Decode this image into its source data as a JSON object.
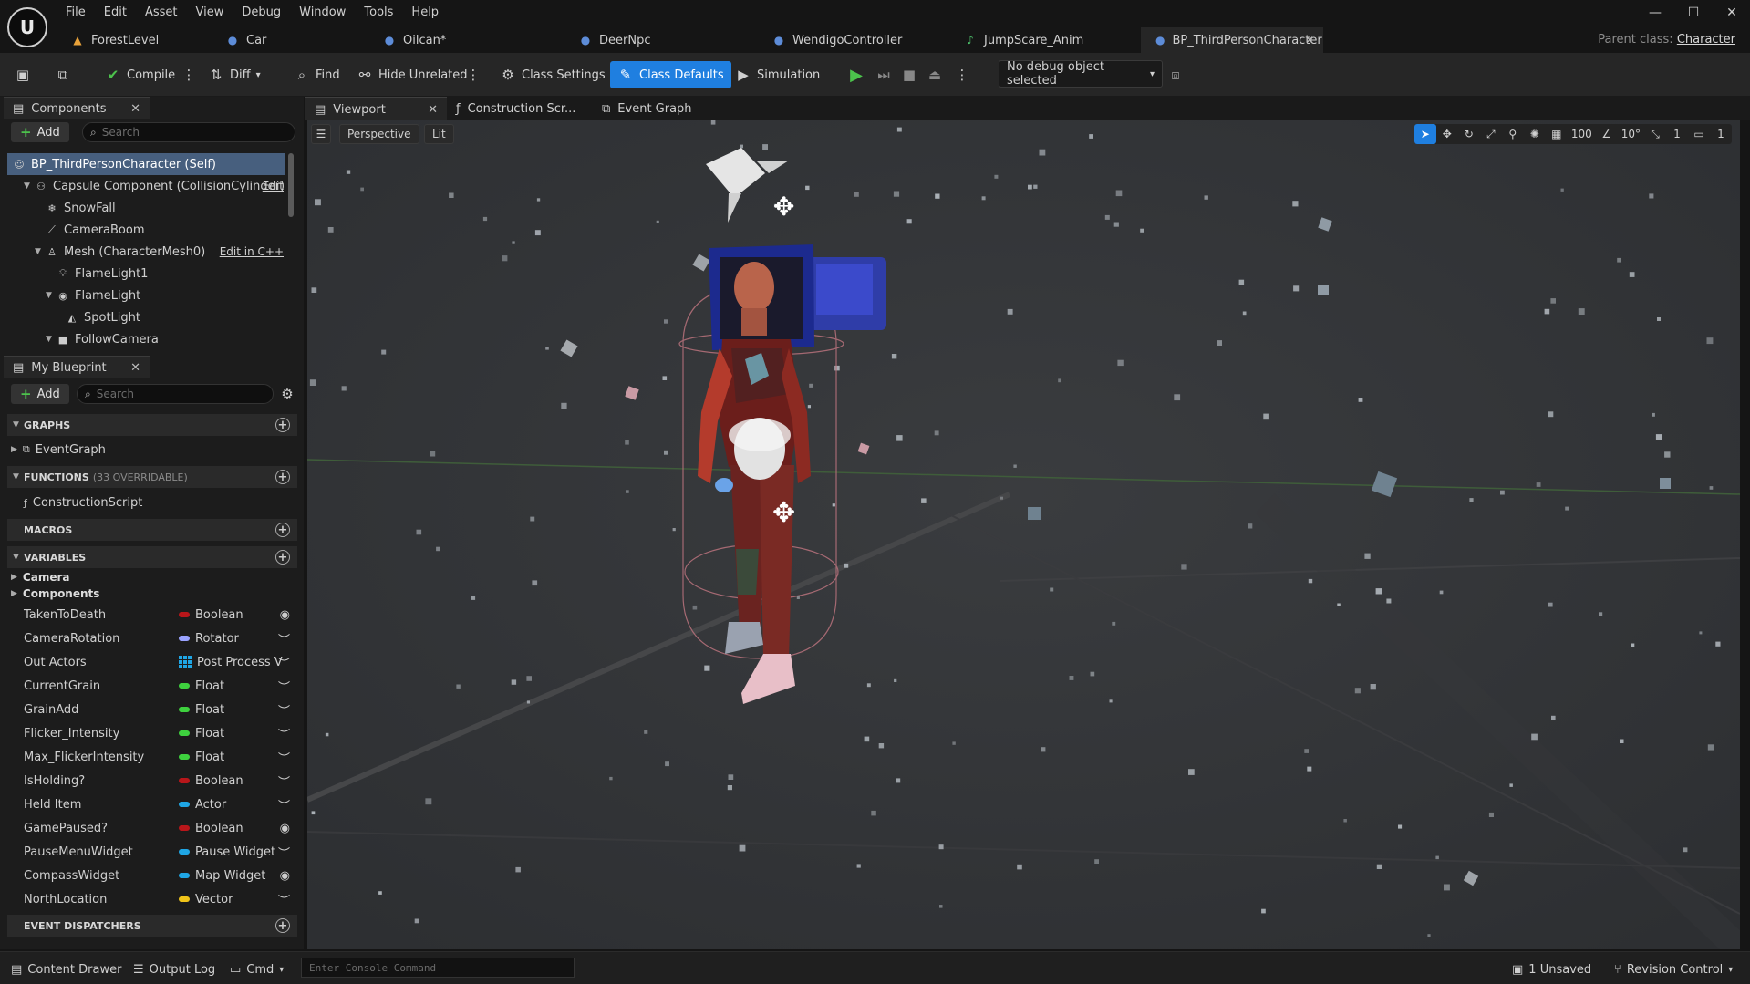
{
  "menu": [
    "File",
    "Edit",
    "Asset",
    "View",
    "Debug",
    "Window",
    "Tools",
    "Help"
  ],
  "window_controls": {
    "minimize": "—",
    "maximize": "☐",
    "close": "✕"
  },
  "tabs": [
    {
      "label": "ForestLevel",
      "icon": "level-icon"
    },
    {
      "label": "Car",
      "icon": "blueprint-icon"
    },
    {
      "label": "Oilcan*",
      "icon": "blueprint-icon"
    },
    {
      "label": "DeerNpc",
      "icon": "blueprint-icon"
    },
    {
      "label": "WendigoController",
      "icon": "blueprint-icon"
    },
    {
      "label": "JumpScare_Anim",
      "icon": "animation-icon"
    },
    {
      "label": "BP_ThirdPersonCharacter",
      "icon": "blueprint-icon",
      "active": true
    }
  ],
  "parent_class": {
    "label": "Parent class:",
    "value": "Character"
  },
  "toolbar": {
    "compile": "Compile",
    "diff": "Diff",
    "find": "Find",
    "hide_unrelated": "Hide Unrelated",
    "class_settings": "Class Settings",
    "class_defaults": "Class Defaults",
    "simulation": "Simulation",
    "debug_object": "No debug object selected"
  },
  "components_panel": {
    "title": "Components",
    "add": "Add",
    "search_placeholder": "Search",
    "items": [
      {
        "label": "BP_ThirdPersonCharacter (Self)",
        "selected": true
      },
      {
        "label": "Capsule Component (CollisionCylinder)",
        "action": "Edit"
      },
      {
        "label": "SnowFall"
      },
      {
        "label": "CameraBoom"
      },
      {
        "label": "Mesh (CharacterMesh0)",
        "action": "Edit in C++"
      },
      {
        "label": "FlameLight1"
      },
      {
        "label": "FlameLight"
      },
      {
        "label": "SpotLight"
      },
      {
        "label": "FollowCamera"
      }
    ]
  },
  "my_blueprint": {
    "title": "My Blueprint",
    "add": "Add",
    "search_placeholder": "Search",
    "graphs": {
      "label": "GRAPHS",
      "items": [
        "EventGraph"
      ]
    },
    "functions": {
      "label": "FUNCTIONS",
      "sub": "(33 OVERRIDABLE)",
      "items": [
        "ConstructionScript"
      ]
    },
    "macros": {
      "label": "MACROS"
    },
    "variables": {
      "label": "VARIABLES",
      "categories": [
        "Camera",
        "Components"
      ],
      "items": [
        {
          "name": "TakenToDeath",
          "type": "Boolean",
          "color": "#b8161a",
          "visible": true
        },
        {
          "name": "CameraRotation",
          "type": "Rotator",
          "color": "#9aa3ff",
          "visible": false
        },
        {
          "name": "Out Actors",
          "type": "Post Process V",
          "color": "#1fa6e5",
          "visible": false,
          "grid": true
        },
        {
          "name": "CurrentGrain",
          "type": "Float",
          "color": "#3ed13e",
          "visible": false
        },
        {
          "name": "GrainAdd",
          "type": "Float",
          "color": "#3ed13e",
          "visible": false
        },
        {
          "name": "Flicker_Intensity",
          "type": "Float",
          "color": "#3ed13e",
          "visible": false
        },
        {
          "name": "Max_FlickerIntensity",
          "type": "Float",
          "color": "#3ed13e",
          "visible": false
        },
        {
          "name": "IsHolding?",
          "type": "Boolean",
          "color": "#b8161a",
          "visible": false
        },
        {
          "name": "Held Item",
          "type": "Actor",
          "color": "#1fa6e5",
          "visible": false
        },
        {
          "name": "GamePaused?",
          "type": "Boolean",
          "color": "#b8161a",
          "visible": true
        },
        {
          "name": "PauseMenuWidget",
          "type": "Pause Widget",
          "color": "#1fa6e5",
          "visible": false
        },
        {
          "name": "CompassWidget",
          "type": "Map Widget",
          "color": "#1fa6e5",
          "visible": true
        },
        {
          "name": "NorthLocation",
          "type": "Vector",
          "color": "#f0c419",
          "visible": false
        }
      ]
    },
    "event_dispatchers": {
      "label": "EVENT DISPATCHERS"
    }
  },
  "viewport_tabs": [
    {
      "label": "Viewport",
      "active": true
    },
    {
      "label": "Construction Scr..."
    },
    {
      "label": "Event Graph"
    }
  ],
  "viewport": {
    "perspective": "Perspective",
    "lit": "Lit",
    "grid_size": "100",
    "angle": "10°",
    "scale": "1",
    "camera_speed": "1"
  },
  "statusbar": {
    "content_drawer": "Content Drawer",
    "output_log": "Output Log",
    "cmd": "Cmd",
    "console_placeholder": "Enter Console Command",
    "unsaved": "1 Unsaved",
    "revision_control": "Revision Control"
  }
}
